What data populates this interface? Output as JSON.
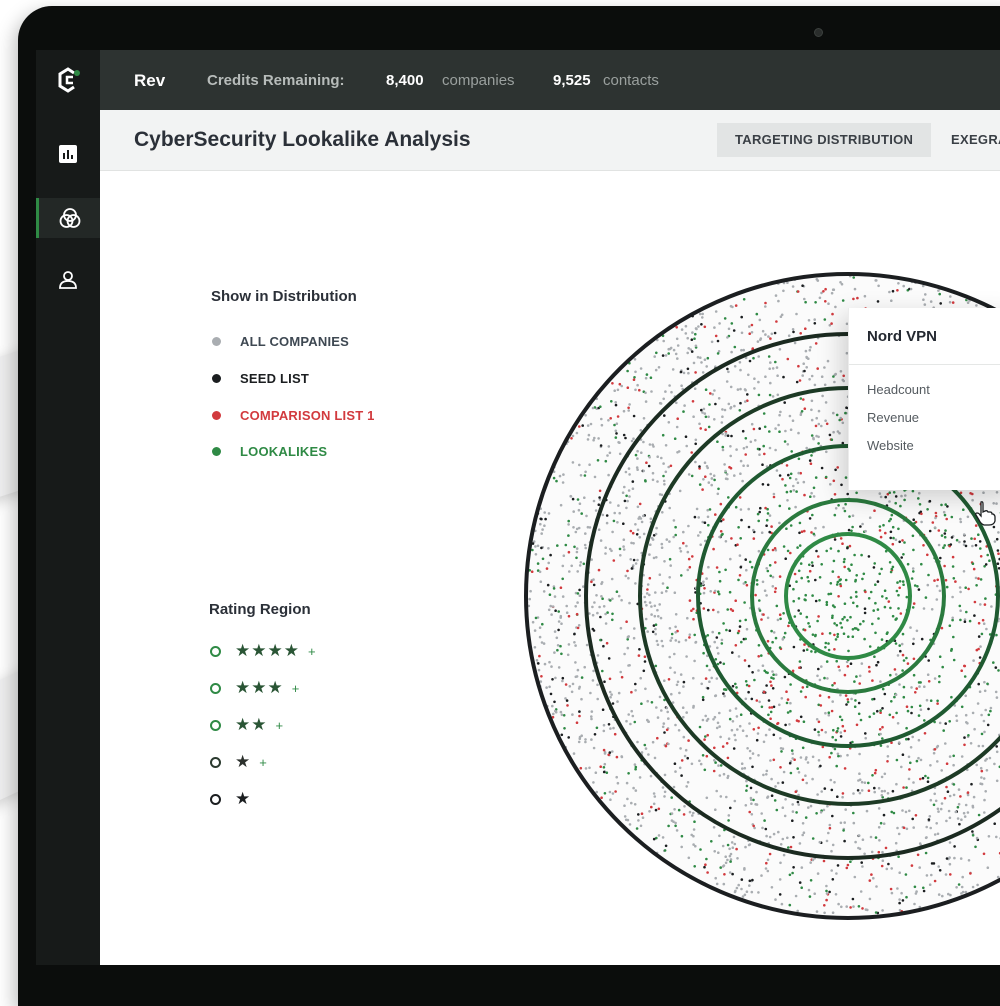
{
  "app": {
    "brand": "Rev",
    "credits_label": "Credits Remaining:",
    "companies_count": "8,400",
    "companies_unit": "companies",
    "contacts_count": "9,525",
    "contacts_unit": "contacts"
  },
  "sidebar": {
    "items": [
      {
        "icon": "bar-chart-icon",
        "active": false
      },
      {
        "icon": "venn-circles-icon",
        "active": true
      },
      {
        "icon": "user-icon",
        "active": false
      }
    ]
  },
  "header": {
    "title": "CyberSecurity Lookalike Analysis",
    "tabs": [
      {
        "label": "TARGETING DISTRIBUTION",
        "active": true
      },
      {
        "label": "EXEGRA",
        "active": false
      }
    ]
  },
  "distribution_legend": {
    "title": "Show in Distribution",
    "items": [
      {
        "label": "ALL COMPANIES",
        "color": "#a9adb1",
        "text_color": "#3e4852"
      },
      {
        "label": "SEED LIST",
        "color": "#1b1e20",
        "text_color": "#1b1e20"
      },
      {
        "label": "COMPARISON LIST 1",
        "color": "#d23a3e",
        "text_color": "#d23a3e"
      },
      {
        "label": "LOOKALIKES",
        "color": "#2f8a45",
        "text_color": "#2f8a45"
      }
    ]
  },
  "rating_legend": {
    "title": "Rating Region",
    "items": [
      {
        "stars": 4,
        "plus": "+"
      },
      {
        "stars": 3,
        "plus": "+"
      },
      {
        "stars": 2,
        "plus": "+"
      },
      {
        "stars": 1,
        "plus": "+"
      },
      {
        "stars": 1,
        "plus": ""
      }
    ]
  },
  "popup": {
    "title": "Nord VPN",
    "fields": [
      "Headcount",
      "Revenue",
      "Website"
    ]
  },
  "colors": {
    "accent_green": "#2f8a45",
    "ring_dark": "#1d3a25",
    "red": "#d23a3e",
    "gray": "#a9adb1",
    "black": "#1b1e20"
  }
}
